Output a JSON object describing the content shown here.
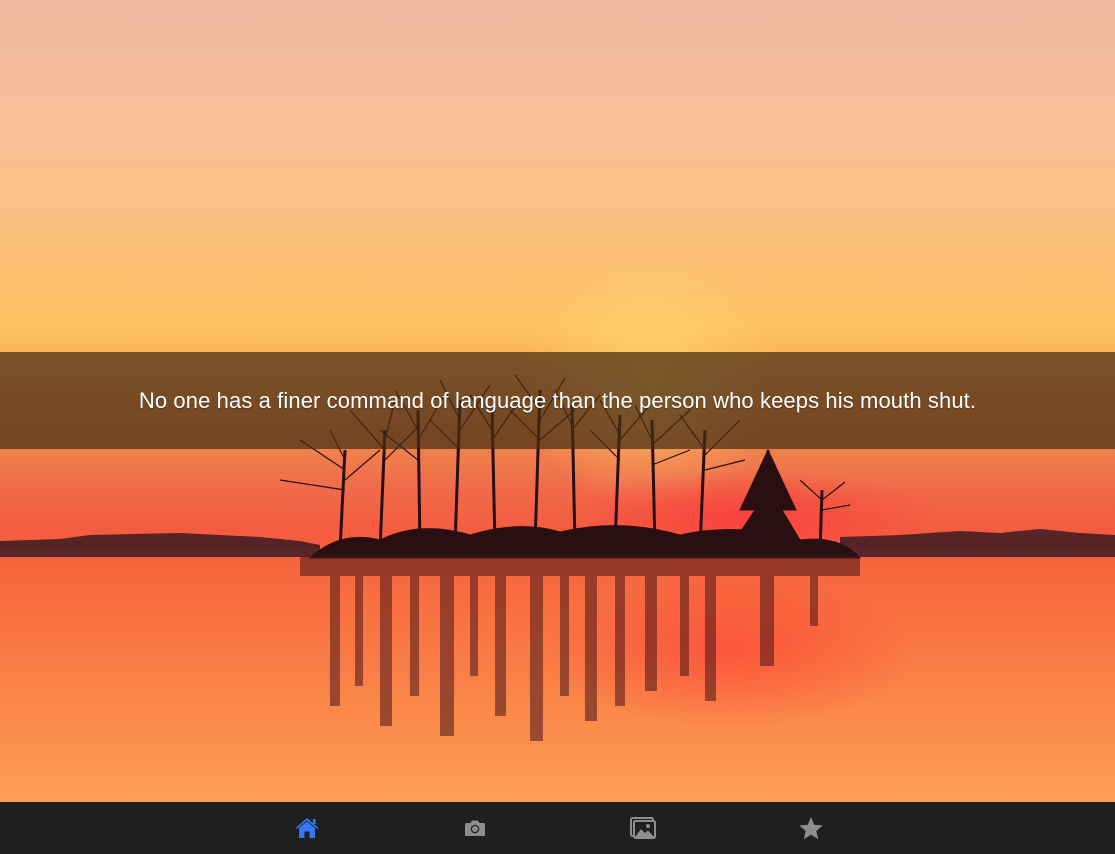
{
  "quote": {
    "text": "No one has a finer command of language than the person who keeps his mouth shut."
  },
  "tab_bar": {
    "tabs": [
      {
        "id": "home",
        "icon": "home-icon",
        "active": true
      },
      {
        "id": "camera",
        "icon": "camera-icon",
        "active": false
      },
      {
        "id": "gallery",
        "icon": "gallery-icon",
        "active": false
      },
      {
        "id": "favorites",
        "icon": "star-icon",
        "active": false
      }
    ],
    "active_color": "#3478f6",
    "inactive_color": "#8e8e8e"
  }
}
